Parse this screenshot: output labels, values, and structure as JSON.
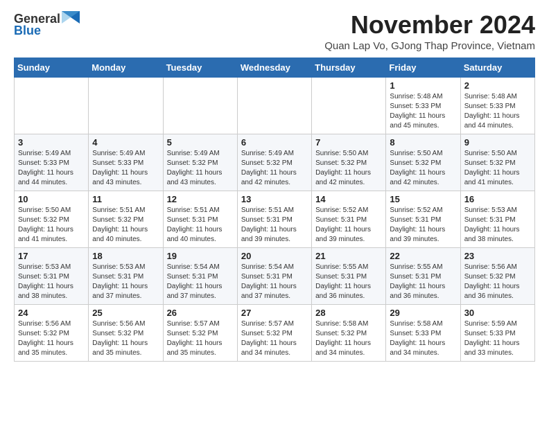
{
  "logo": {
    "general": "General",
    "blue": "Blue",
    "tagline": "GeneralBlue"
  },
  "header": {
    "month_title": "November 2024",
    "location": "Quan Lap Vo, GJong Thap Province, Vietnam"
  },
  "days_of_week": [
    "Sunday",
    "Monday",
    "Tuesday",
    "Wednesday",
    "Thursday",
    "Friday",
    "Saturday"
  ],
  "weeks": [
    [
      {
        "day": "",
        "info": ""
      },
      {
        "day": "",
        "info": ""
      },
      {
        "day": "",
        "info": ""
      },
      {
        "day": "",
        "info": ""
      },
      {
        "day": "",
        "info": ""
      },
      {
        "day": "1",
        "info": "Sunrise: 5:48 AM\nSunset: 5:33 PM\nDaylight: 11 hours and 45 minutes."
      },
      {
        "day": "2",
        "info": "Sunrise: 5:48 AM\nSunset: 5:33 PM\nDaylight: 11 hours and 44 minutes."
      }
    ],
    [
      {
        "day": "3",
        "info": "Sunrise: 5:49 AM\nSunset: 5:33 PM\nDaylight: 11 hours and 44 minutes."
      },
      {
        "day": "4",
        "info": "Sunrise: 5:49 AM\nSunset: 5:33 PM\nDaylight: 11 hours and 43 minutes."
      },
      {
        "day": "5",
        "info": "Sunrise: 5:49 AM\nSunset: 5:32 PM\nDaylight: 11 hours and 43 minutes."
      },
      {
        "day": "6",
        "info": "Sunrise: 5:49 AM\nSunset: 5:32 PM\nDaylight: 11 hours and 42 minutes."
      },
      {
        "day": "7",
        "info": "Sunrise: 5:50 AM\nSunset: 5:32 PM\nDaylight: 11 hours and 42 minutes."
      },
      {
        "day": "8",
        "info": "Sunrise: 5:50 AM\nSunset: 5:32 PM\nDaylight: 11 hours and 42 minutes."
      },
      {
        "day": "9",
        "info": "Sunrise: 5:50 AM\nSunset: 5:32 PM\nDaylight: 11 hours and 41 minutes."
      }
    ],
    [
      {
        "day": "10",
        "info": "Sunrise: 5:50 AM\nSunset: 5:32 PM\nDaylight: 11 hours and 41 minutes."
      },
      {
        "day": "11",
        "info": "Sunrise: 5:51 AM\nSunset: 5:32 PM\nDaylight: 11 hours and 40 minutes."
      },
      {
        "day": "12",
        "info": "Sunrise: 5:51 AM\nSunset: 5:31 PM\nDaylight: 11 hours and 40 minutes."
      },
      {
        "day": "13",
        "info": "Sunrise: 5:51 AM\nSunset: 5:31 PM\nDaylight: 11 hours and 39 minutes."
      },
      {
        "day": "14",
        "info": "Sunrise: 5:52 AM\nSunset: 5:31 PM\nDaylight: 11 hours and 39 minutes."
      },
      {
        "day": "15",
        "info": "Sunrise: 5:52 AM\nSunset: 5:31 PM\nDaylight: 11 hours and 39 minutes."
      },
      {
        "day": "16",
        "info": "Sunrise: 5:53 AM\nSunset: 5:31 PM\nDaylight: 11 hours and 38 minutes."
      }
    ],
    [
      {
        "day": "17",
        "info": "Sunrise: 5:53 AM\nSunset: 5:31 PM\nDaylight: 11 hours and 38 minutes."
      },
      {
        "day": "18",
        "info": "Sunrise: 5:53 AM\nSunset: 5:31 PM\nDaylight: 11 hours and 37 minutes."
      },
      {
        "day": "19",
        "info": "Sunrise: 5:54 AM\nSunset: 5:31 PM\nDaylight: 11 hours and 37 minutes."
      },
      {
        "day": "20",
        "info": "Sunrise: 5:54 AM\nSunset: 5:31 PM\nDaylight: 11 hours and 37 minutes."
      },
      {
        "day": "21",
        "info": "Sunrise: 5:55 AM\nSunset: 5:31 PM\nDaylight: 11 hours and 36 minutes."
      },
      {
        "day": "22",
        "info": "Sunrise: 5:55 AM\nSunset: 5:31 PM\nDaylight: 11 hours and 36 minutes."
      },
      {
        "day": "23",
        "info": "Sunrise: 5:56 AM\nSunset: 5:32 PM\nDaylight: 11 hours and 36 minutes."
      }
    ],
    [
      {
        "day": "24",
        "info": "Sunrise: 5:56 AM\nSunset: 5:32 PM\nDaylight: 11 hours and 35 minutes."
      },
      {
        "day": "25",
        "info": "Sunrise: 5:56 AM\nSunset: 5:32 PM\nDaylight: 11 hours and 35 minutes."
      },
      {
        "day": "26",
        "info": "Sunrise: 5:57 AM\nSunset: 5:32 PM\nDaylight: 11 hours and 35 minutes."
      },
      {
        "day": "27",
        "info": "Sunrise: 5:57 AM\nSunset: 5:32 PM\nDaylight: 11 hours and 34 minutes."
      },
      {
        "day": "28",
        "info": "Sunrise: 5:58 AM\nSunset: 5:32 PM\nDaylight: 11 hours and 34 minutes."
      },
      {
        "day": "29",
        "info": "Sunrise: 5:58 AM\nSunset: 5:33 PM\nDaylight: 11 hours and 34 minutes."
      },
      {
        "day": "30",
        "info": "Sunrise: 5:59 AM\nSunset: 5:33 PM\nDaylight: 11 hours and 33 minutes."
      }
    ]
  ]
}
